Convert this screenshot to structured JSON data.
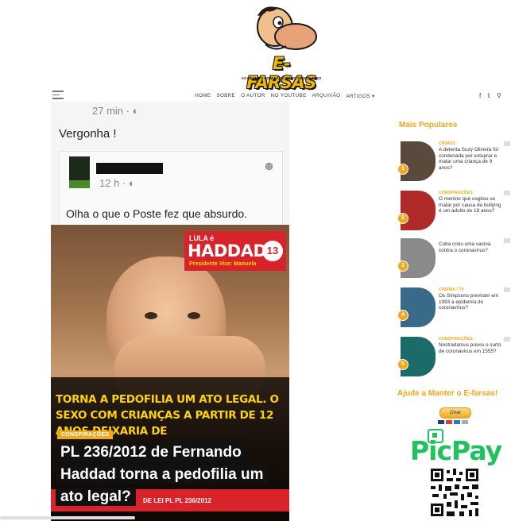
{
  "site": {
    "logo_text": "E-FARSAS",
    "logo_tagline": "ACABANDO COM FAKE NEWS DESDE 2002!"
  },
  "nav": {
    "items": [
      "HOME",
      "SOBRE",
      "O AUTOR",
      "NO YOUTUBE",
      "ARQUIVÃO",
      "ARTIGOS ▾"
    ],
    "icons": [
      "facebook-icon",
      "twitter-icon",
      "search-icon"
    ],
    "facebook_glyph": "f",
    "twitter_glyph": "🐦",
    "search_glyph": "⌕"
  },
  "post": {
    "top_time": "27 min · ◐",
    "comment": "Vergonha !",
    "inner_time": "12 h · ◐",
    "inner_text": "Olha o que o Poste fez que absurdo.",
    "image": {
      "badge_top": "LULA é",
      "badge_name": "HADDAD",
      "badge_number": "13",
      "badge_sub": "Presidente   Vice: Manuela",
      "yellow_text": "TORNA A PEDOFILIA UM ATO LEGAL. O SEXO COM CRIANÇAS A PARTIR DE 12 ANOS DEIXARIA DE",
      "red_text": "DE LEI PL PL 236/2012"
    },
    "category": "CONSPIRAÇÕES",
    "headline_lines": [
      "PL 236/2012 de Fernando",
      "Haddad torna a pedofilia um",
      "ato legal?"
    ]
  },
  "sidebar": {
    "title": "Mais Populares",
    "items": [
      {
        "rank": "1",
        "category": "CRIMES",
        "text": "A detenta Suzy Oliveira foi condenada por estuprar e matar uma criança de 9 anos?",
        "thumb_color": "#5a4a3c"
      },
      {
        "rank": "2",
        "category": "CONSPIRAÇÕES",
        "text": "O menino que cogitou se matar por causa de bullying é um adulto de 18 anos?",
        "thumb_color": "#b02a2a"
      },
      {
        "rank": "3",
        "category": "",
        "text": "Cuba criou uma vacina contra o coronavírus?",
        "thumb_color": "#8a8a8a"
      },
      {
        "rank": "4",
        "category": "CINEMA / TV",
        "text": "Os Simpsons previram em 1993 a epidemia do coronavírus?",
        "thumb_color": "#3a6a8a"
      },
      {
        "rank": "5",
        "category": "CONSPIRAÇÕES",
        "text": "Nostradamus previu o surto de coronavírus em 1555?",
        "thumb_color": "#1c6b6b"
      }
    ],
    "support_title": "Ajude a Manter o E-farsas!",
    "donate_label": "Doar",
    "picpay_label": "PicPay"
  }
}
